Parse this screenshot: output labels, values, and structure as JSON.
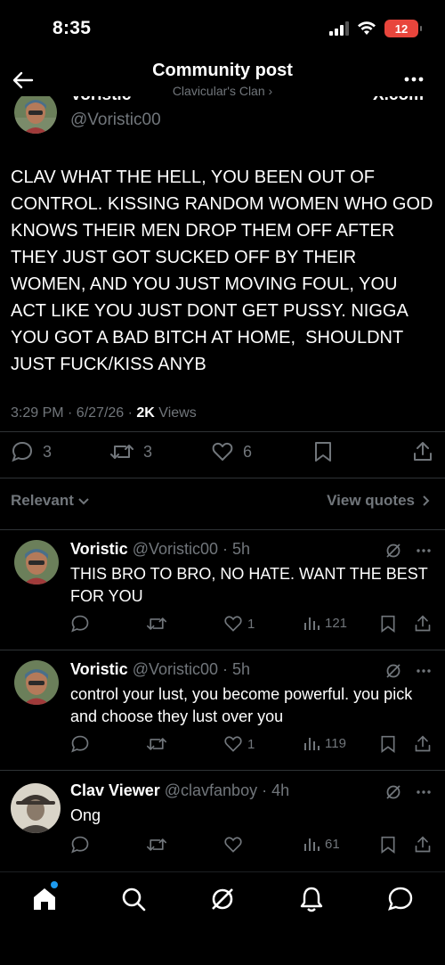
{
  "status_bar": {
    "time": "8:35",
    "battery": "12"
  },
  "nav": {
    "title": "Community post",
    "subtitle": "Clavicular's Clan ›"
  },
  "post": {
    "cut_name": "Voristic",
    "cut_right": "X.com",
    "handle": "@Voristic00",
    "text": "CLAV WHAT THE HELL, YOU BEEN OUT OF CONTROL. KISSING RANDOM WOMEN WHO GOD KNOWS THEIR MEN DROP THEM OFF AFTER THEY JUST GOT SUCKED OFF BY THEIR WOMEN, AND YOU JUST MOVING FOUL, YOU ACT LIKE YOU JUST DONT GET PUSSY. NIGGA YOU GOT A BAD BITCH AT HOME,  SHOULDNT JUST FUCK/KISS ANYB",
    "time_date": "3:29 PM · 6/27/26 · ",
    "views_count": "2K",
    "views_label": " Views",
    "replies": "3",
    "reposts": "3",
    "likes": "6"
  },
  "sort": {
    "relevant": "Relevant",
    "view_quotes": "View quotes"
  },
  "replies": [
    {
      "name": "Voristic",
      "handle": "@Voristic00 · 5h",
      "text": "THIS BRO TO BRO, NO HATE. WANT THE BEST FOR YOU",
      "likes": "1",
      "views": "121"
    },
    {
      "name": "Voristic",
      "handle": "@Voristic00 · 5h",
      "text": "control your lust, you become powerful. you pick and choose they lust over you",
      "likes": "1",
      "views": "119"
    },
    {
      "name": "Clav Viewer",
      "handle": "@clavfanboy · 4h",
      "text": "Ong",
      "likes": "",
      "views": "61"
    }
  ],
  "colors": {
    "background": "#000000",
    "text": "#e7e9ea",
    "muted": "#71767b",
    "accent": "#1d9bf0",
    "battery": "#e8453c"
  },
  "icons": [
    "back-arrow-icon",
    "more-icon",
    "reply-icon",
    "repost-icon",
    "like-icon",
    "bookmark-icon",
    "share-icon",
    "grok-icon",
    "views-icon",
    "home-icon",
    "search-icon",
    "bell-icon",
    "messages-icon"
  ]
}
